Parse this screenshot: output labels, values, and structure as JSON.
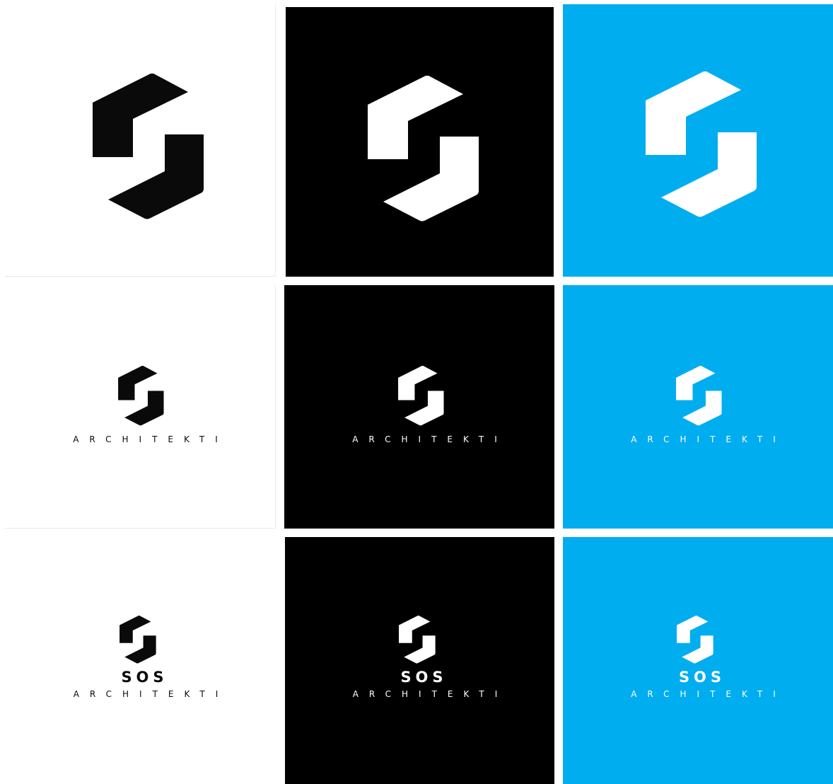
{
  "colors": {
    "white_bg": "#ffffff",
    "black_bg": "#000000",
    "blue_bg": "#00adef",
    "mark_on_white": "#0a0a0a",
    "mark_on_color": "#ffffff"
  },
  "logo_icon": "s-hexagon-logo-icon",
  "rows": [
    {
      "variant": "symbol",
      "tiles": [
        {
          "bg": "white"
        },
        {
          "bg": "black"
        },
        {
          "bg": "blue"
        }
      ]
    },
    {
      "variant": "symbol-with-subtitle",
      "subtitle": "ARCHITEKTI",
      "tiles": [
        {
          "bg": "white"
        },
        {
          "bg": "black"
        },
        {
          "bg": "blue"
        }
      ]
    },
    {
      "variant": "full-lockup",
      "name": "SOS",
      "subtitle": "ARCHITEKTI",
      "tiles": [
        {
          "bg": "white"
        },
        {
          "bg": "black"
        },
        {
          "bg": "blue"
        }
      ]
    }
  ]
}
